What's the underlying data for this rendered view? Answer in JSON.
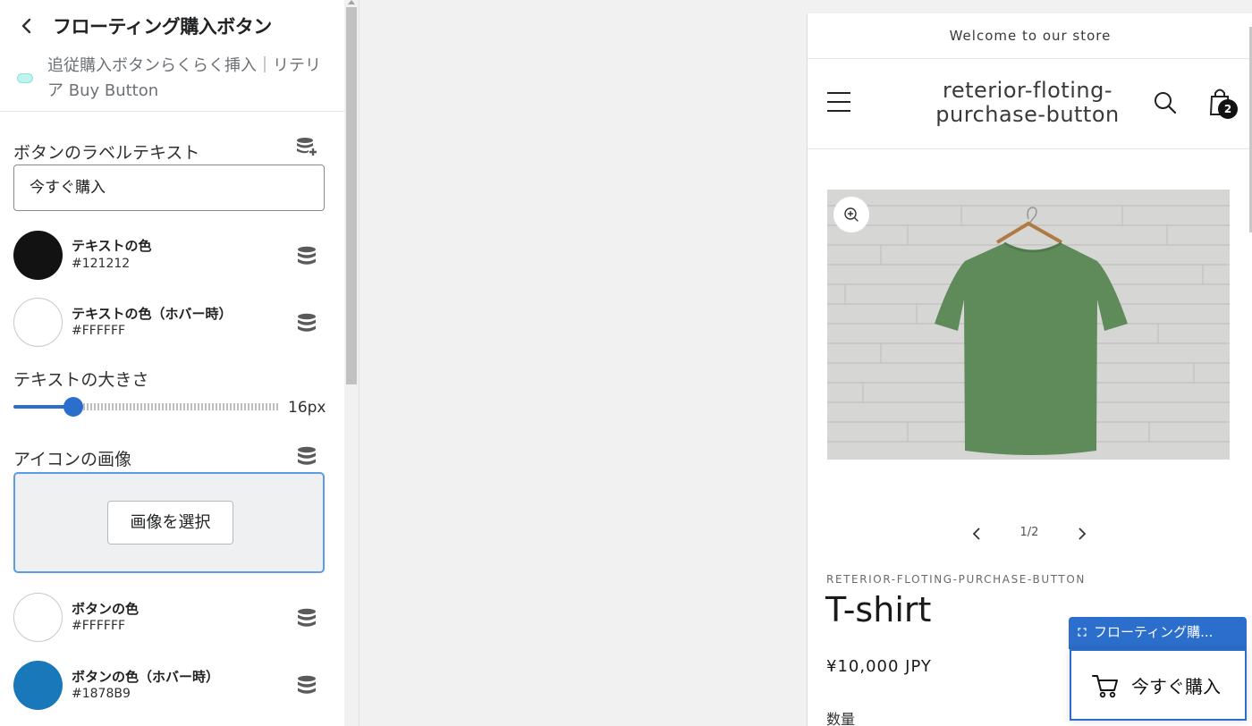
{
  "sidebar": {
    "title": "フローティング購入ボタン",
    "app_name": "追従購入ボタンらくらく挿入｜リテリア Buy Button",
    "label_text_title": "ボタンのラベルテキスト",
    "label_text_value": "今すぐ購入",
    "text_color": {
      "name": "テキストの色",
      "hex": "#121212"
    },
    "text_hover_color": {
      "name": "テキストの色（ホバー時）",
      "hex": "#FFFFFF"
    },
    "text_size_title": "テキストの大きさ",
    "text_size_value": "16px",
    "text_size_level": 0.22,
    "icon_image_title": "アイコンの画像",
    "select_image_label": "画像を選択",
    "button_color": {
      "name": "ボタンの色",
      "hex": "#FFFFFF"
    },
    "button_hover_color": {
      "name": "ボタンの色（ホバー時）",
      "hex": "#1878B9"
    }
  },
  "preview": {
    "announcement": "Welcome to our store",
    "store_name": "reterior-floting-purchase-button",
    "cart_count": "2",
    "pager": "1/2",
    "vendor": "RETERIOR-FLOTING-PURCHASE-BUTTON",
    "product_title": "T-shirt",
    "price": "¥10,000 JPY",
    "quantity_label": "数量",
    "floating_label": "フローティング購...",
    "floating_button_text": "今すぐ購入"
  },
  "colors": {
    "accent": "#2c6ecb",
    "tshirt": "#5f8a5a"
  },
  "icons": [
    "back-chevron-icon",
    "database-add-icon",
    "database-icon",
    "menu-icon",
    "search-icon",
    "cart-icon",
    "zoom-in-icon",
    "chevron-left-icon",
    "chevron-right-icon",
    "select-icon"
  ]
}
